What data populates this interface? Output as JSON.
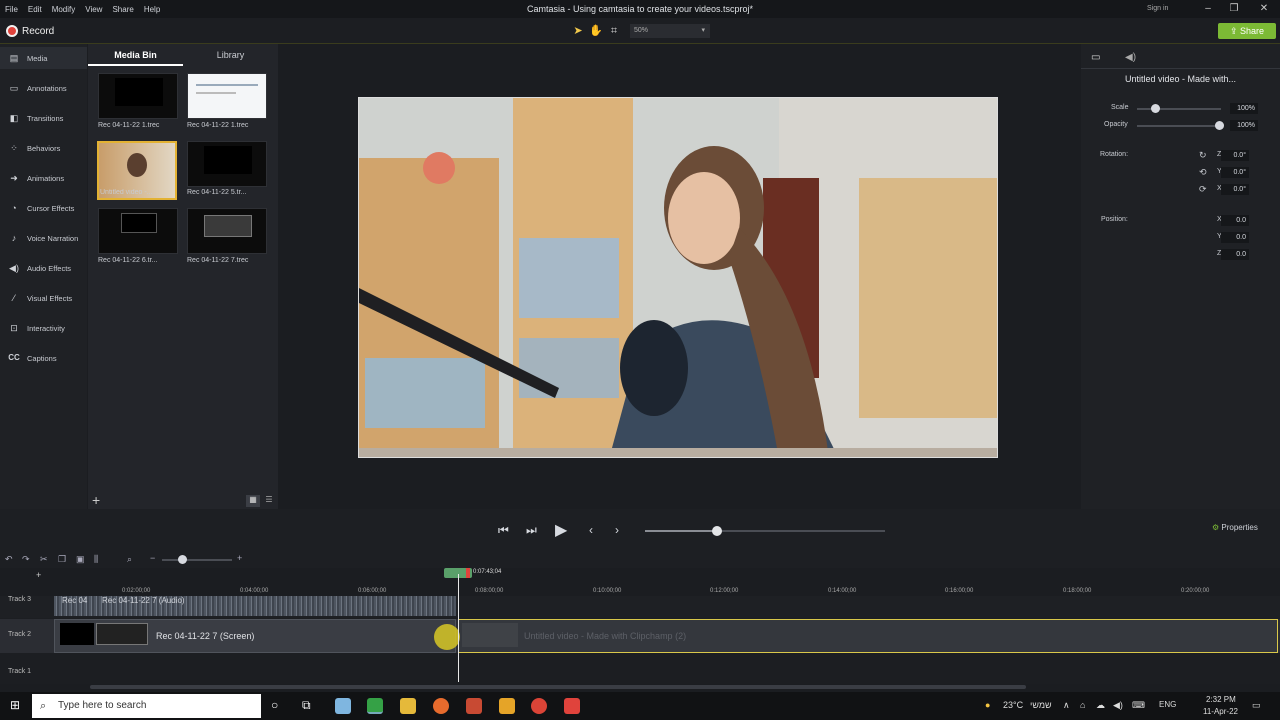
{
  "menu": [
    "File",
    "Edit",
    "Modify",
    "View",
    "Share",
    "Help"
  ],
  "window_title": "Camtasia - Using camtasia to create your videos.tscproj*",
  "sign_in": "Sign in",
  "toolbar": {
    "record_label": "Record",
    "zoom": "50%",
    "share_label": "Share"
  },
  "sidebar": {
    "items": [
      {
        "label": "Media",
        "icon": "film-icon"
      },
      {
        "label": "Annotations",
        "icon": "annotation-icon"
      },
      {
        "label": "Transitions",
        "icon": "transition-icon"
      },
      {
        "label": "Behaviors",
        "icon": "behavior-icon"
      },
      {
        "label": "Animations",
        "icon": "animation-icon"
      },
      {
        "label": "Cursor Effects",
        "icon": "cursor-icon"
      },
      {
        "label": "Voice Narration",
        "icon": "microphone-icon"
      },
      {
        "label": "Audio Effects",
        "icon": "speaker-icon"
      },
      {
        "label": "Visual Effects",
        "icon": "wand-icon"
      },
      {
        "label": "Interactivity",
        "icon": "interactivity-icon"
      },
      {
        "label": "Captions",
        "icon": "cc-icon"
      }
    ]
  },
  "bin": {
    "tabs": [
      "Media Bin",
      "Library"
    ],
    "items": [
      "Rec 04-11-22 1.trec",
      "Rec 04-11-22 1.trec",
      "Untitled video -...",
      "Rec 04-11-22 5.tr...",
      "Rec 04-11-22 6.tr...",
      "Rec 04-11-22 7.trec"
    ]
  },
  "properties": {
    "title": "Untitled video - Made with...",
    "scale_label": "Scale",
    "scale_value": "100%",
    "scale_level": 1.0,
    "opacity_label": "Opacity",
    "opacity_value": "100%",
    "opacity_level": 1.0,
    "rotation_label": "Rotation:",
    "rot_z_label": "Z:",
    "rot_y_label": "Y:",
    "rot_x_label": "X:",
    "rot_z": "0.0°",
    "rot_y": "0.0°",
    "rot_x": "0.0°",
    "position_label": "Position:",
    "pos_x_label": "X:",
    "pos_y_label": "Y:",
    "pos_z_label": "Z:",
    "pos_x": "0.0",
    "pos_y": "0.0",
    "pos_z": "0.0"
  },
  "transport": {
    "properties_label": "Properties"
  },
  "timeline": {
    "playhead": "0:07:43;04",
    "ticks": [
      "0:02:00;00",
      "0:04:00;00",
      "0:06:00;00",
      "0:08:00;00",
      "0:10:00;00",
      "0:12:00;00",
      "0:14:00;00",
      "0:16:00;00",
      "0:18:00;00",
      "0:20:00;00"
    ],
    "tracks": [
      "Track 3",
      "Track 2",
      "Track 1"
    ],
    "clip_audio": "Rec 04-11-22 7 (Audio)",
    "clip_audio_short": "Rec 04",
    "clip_screen": "Rec 04-11-22 7 (Screen)",
    "clip_ghost": "Untitled video - Made with Clipchamp (2)"
  },
  "taskbar": {
    "search_placeholder": "Type here to search",
    "weather": "23°C",
    "weather_text": "שמשי",
    "lang": "ENG",
    "time": "2:32 PM",
    "date": "11-Apr-22"
  }
}
